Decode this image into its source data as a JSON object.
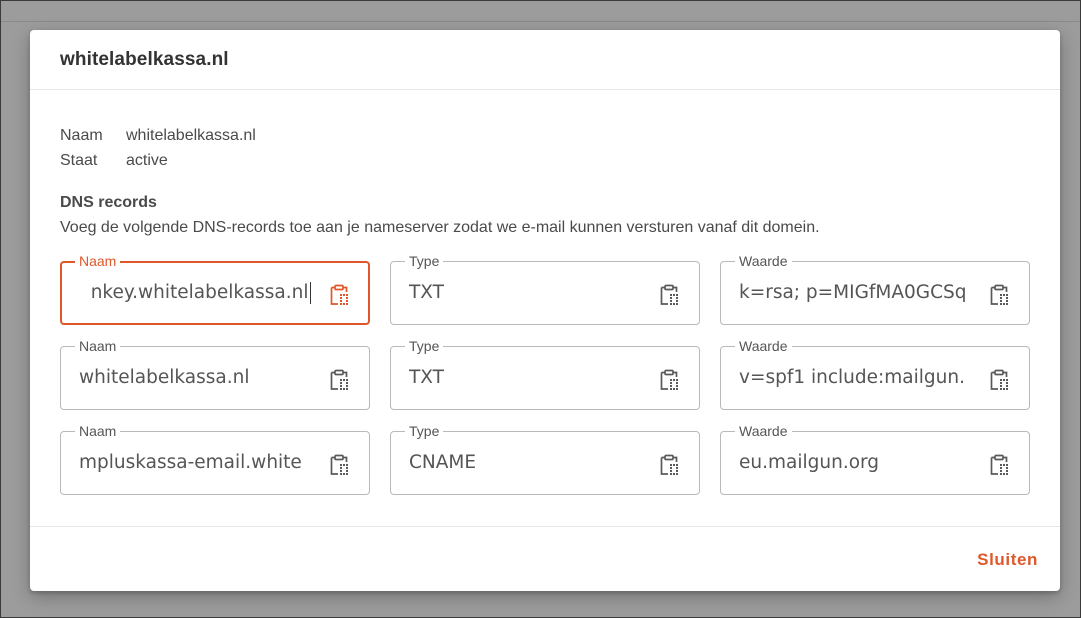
{
  "dialog": {
    "title": "whitelabelkassa.nl",
    "info": [
      {
        "key": "Naam",
        "value": "whitelabelkassa.nl"
      },
      {
        "key": "Staat",
        "value": "active"
      }
    ],
    "section_title": "DNS records",
    "section_desc": "Voeg de volgende DNS-records toe aan je nameserver zodat we e-mail kunnen versturen vanaf dit domein.",
    "records": [
      {
        "naam": {
          "label": "Naam",
          "value": "nkey.whitelabelkassa.nl"
        },
        "type": {
          "label": "Type",
          "value": "TXT"
        },
        "waarde": {
          "label": "Waarde",
          "value": "k=rsa; p=MIGfMA0GCSq"
        }
      },
      {
        "naam": {
          "label": "Naam",
          "value": "whitelabelkassa.nl"
        },
        "type": {
          "label": "Type",
          "value": "TXT"
        },
        "waarde": {
          "label": "Waarde",
          "value": "v=spf1 include:mailgun."
        }
      },
      {
        "naam": {
          "label": "Naam",
          "value": "mpluskassa-email.white"
        },
        "type": {
          "label": "Type",
          "value": "CNAME"
        },
        "waarde": {
          "label": "Waarde",
          "value": "eu.mailgun.org"
        }
      }
    ],
    "close_label": "Sluiten"
  },
  "colors": {
    "accent": "#e0572a",
    "backdrop": "#9c9c9c",
    "text": "#4a4a4a",
    "border": "#b9b9b9"
  },
  "icons": {
    "copy": "clipboard-copy-icon"
  }
}
